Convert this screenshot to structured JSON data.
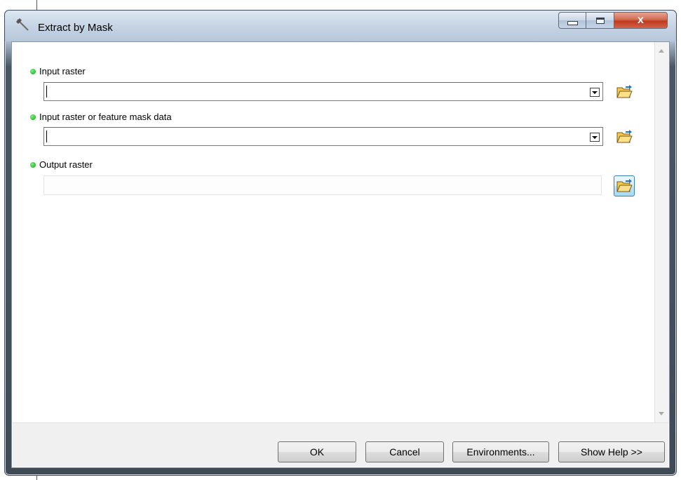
{
  "window": {
    "title": "Extract by Mask",
    "close_glyph": "x"
  },
  "parameters": [
    {
      "label": "Input raster",
      "value": "",
      "control": "combo",
      "required": true
    },
    {
      "label": "Input raster or feature mask data",
      "value": "",
      "control": "combo",
      "required": true
    },
    {
      "label": "Output raster",
      "value": "",
      "control": "textbox",
      "required": true
    }
  ],
  "buttons": {
    "ok": "OK",
    "cancel": "Cancel",
    "environments": "Environments...",
    "show_help": "Show Help >>"
  },
  "icons": {
    "title": "hammer-tool-icon",
    "browse": "open-folder-icon",
    "required": "green-dot-icon"
  },
  "colors": {
    "required_dot": "#2bc22b",
    "close_button": "#c8422a",
    "browse_highlight": "#bee6fd"
  }
}
